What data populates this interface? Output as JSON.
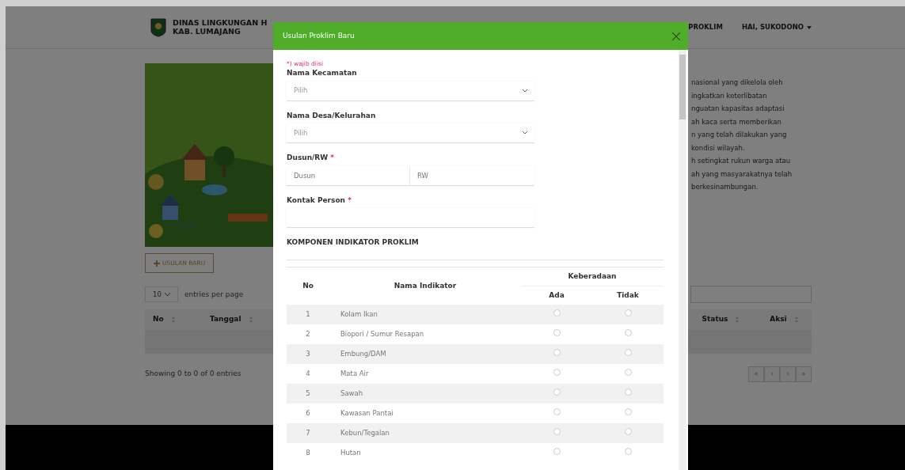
{
  "navbar": {
    "brand_lines": [
      "DINAS LINGKUNGAN H",
      "KAB. LUMAJANG"
    ],
    "menu": [
      {
        "label": "PROKLIM",
        "dropdown": false
      },
      {
        "label": "HAI, SUKODONO",
        "dropdown": true
      }
    ]
  },
  "hero": {
    "kind": "picture",
    "text_lines": [
      "nasional yang dikelola oleh",
      "ingkatkan keterlibatan",
      "nguatan kapasitas adaptasi",
      "ah kaca serta memberikan",
      "n yang telah dilakukan yang",
      "kondisi wilayah.",
      "h setingkat rukun warga atau",
      "ah yang masyarakatnya telah",
      "berkesinambungan."
    ]
  },
  "new_button": {
    "label": "USULAN BARU"
  },
  "entries": {
    "value": "10",
    "label": "entries per page"
  },
  "list_table": {
    "columns": [
      "No",
      "Tanggal",
      "Status",
      "Aksi"
    ]
  },
  "info": "Showing 0 to 0 of 0 entries",
  "pagination": [
    "«",
    "‹",
    "›",
    "»"
  ],
  "modal": {
    "title": "Usulan Proklim Baru",
    "note": "*) wajib diisi",
    "fields": [
      {
        "kind": "select",
        "label": "Nama Kecamatan",
        "placeholder": "Pilih"
      },
      {
        "kind": "select",
        "label": "Nama Desa/Kelurahan",
        "placeholder": "Pilih"
      },
      {
        "kind": "pair",
        "label": "Dusun/RW",
        "required_mark": "*",
        "placeholders": [
          "Dusun",
          "RW"
        ]
      },
      {
        "kind": "text",
        "label": "Kontak Person",
        "required_mark": "*"
      }
    ],
    "section_title": "KOMPONEN INDIKATOR PROKLIM",
    "indicator_table": {
      "no_label": "No",
      "name_label": "Nama Indikator",
      "group_label": "Keberadaan",
      "options": [
        "Ada",
        "Tidak"
      ],
      "rows": [
        {
          "no": "1",
          "name": "Kolam Ikan",
          "ada": false,
          "tidak": false
        },
        {
          "no": "2",
          "name": "Biopori / Sumur Resapan",
          "ada": false,
          "tidak": false
        },
        {
          "no": "3",
          "name": "Embung/DAM",
          "ada": false,
          "tidak": false
        },
        {
          "no": "4",
          "name": "Mata Air",
          "ada": false,
          "tidak": false
        },
        {
          "no": "5",
          "name": "Sawah",
          "ada": false,
          "tidak": false
        },
        {
          "no": "6",
          "name": "Kawasan Pantai",
          "ada": false,
          "tidak": false
        },
        {
          "no": "7",
          "name": "Kebun/Tegalan",
          "ada": false,
          "tidak": false
        },
        {
          "no": "8",
          "name": "Hutan",
          "ada": false,
          "tidak": false
        }
      ]
    }
  }
}
